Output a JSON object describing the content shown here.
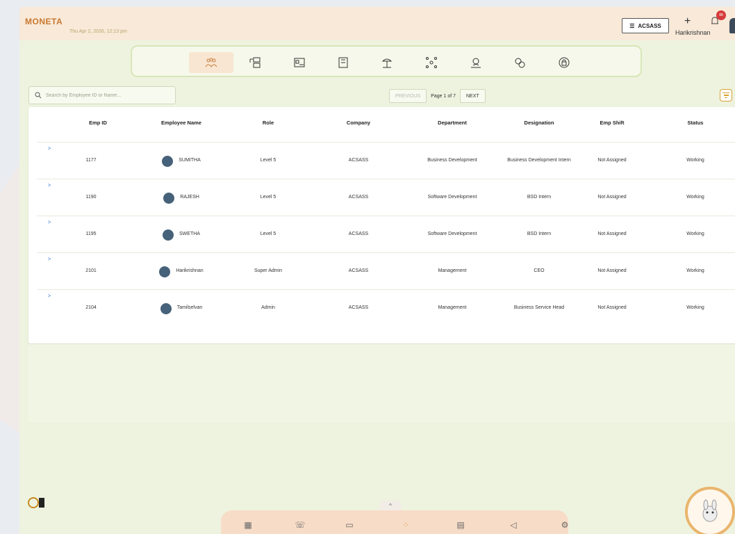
{
  "app": {
    "logo": "MONETA",
    "datetime": "Thu Apr 2, 2026, 12:13 pm"
  },
  "header": {
    "company": "ACSASS",
    "user_name": "Harikrishnan",
    "notification_count": "88",
    "add_icon": "plus-icon",
    "bell_icon": "bell-icon"
  },
  "module_nav": {
    "icons": [
      "employees-icon",
      "workflow-icon",
      "id-card-icon",
      "building-icon",
      "holiday-icon",
      "network-icon",
      "payroll-icon",
      "money-icon",
      "security-icon"
    ],
    "active_index": 0
  },
  "search": {
    "placeholder": "Search by Employee ID or Name..."
  },
  "pagination": {
    "previous": "PREVIOUS",
    "page_text": "Page 1 of 7",
    "next": "NEXT"
  },
  "table": {
    "columns": [
      "Emp ID",
      "Employee Name",
      "Role",
      "Company",
      "Department",
      "Designation",
      "Emp Shift",
      "Status"
    ],
    "rows": [
      {
        "expand": ">",
        "emp_id": "1177",
        "name": "SUMITHA",
        "role": "Level 5",
        "company": "ACSASS",
        "department": "Business Development",
        "designation": "Business Development Intern",
        "shift": "Not Assigned",
        "status": "Working"
      },
      {
        "expand": ">",
        "emp_id": "1190",
        "name": "RAJESH",
        "role": "Level 5",
        "company": "ACSASS",
        "department": "Software Development",
        "designation": "BSD Intern",
        "shift": "Not Assigned",
        "status": "Working"
      },
      {
        "expand": ">",
        "emp_id": "1195",
        "name": "SWETHA",
        "role": "Level 5",
        "company": "ACSASS",
        "department": "Software Development",
        "designation": "BSD Intern",
        "shift": "Not Assigned",
        "status": "Working"
      },
      {
        "expand": ">",
        "emp_id": "2101",
        "name": "Harikrishnan",
        "role": "Super Admin",
        "company": "ACSASS",
        "department": "Management",
        "designation": "CEO",
        "shift": "Not Assigned",
        "status": "Working"
      },
      {
        "expand": ">",
        "emp_id": "2104",
        "name": "Tamilselvan",
        "role": "Admin",
        "company": "ACSASS",
        "department": "Management",
        "designation": "Business Service Head",
        "shift": "Not Assigned",
        "status": "Working"
      }
    ]
  },
  "dock": {
    "toggle": "^",
    "icons": [
      "dashboard-icon",
      "phone-icon",
      "video-icon",
      "apps-icon",
      "document-icon",
      "megaphone-icon",
      "settings-icon"
    ]
  },
  "colors": {
    "accent": "#d7a232",
    "topbar": "#f8e9d8",
    "panel": "#eef3df",
    "link": "#3a7bd5"
  }
}
